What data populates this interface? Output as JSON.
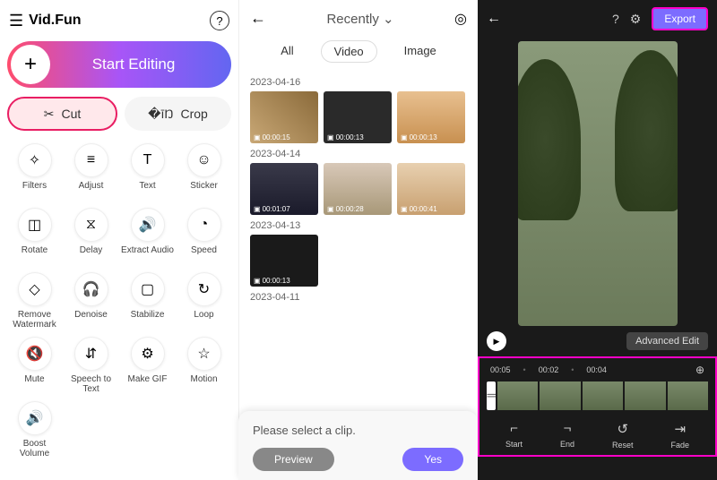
{
  "p1": {
    "logo": "Vid.Fun",
    "start": "Start Editing",
    "cut": "Cut",
    "crop": "Crop",
    "tools": [
      {
        "label": "Filters",
        "icon": "✧"
      },
      {
        "label": "Adjust",
        "icon": "≡"
      },
      {
        "label": "Text",
        "icon": "T"
      },
      {
        "label": "Sticker",
        "icon": "☺"
      },
      {
        "label": "Rotate",
        "icon": "◫"
      },
      {
        "label": "Delay",
        "icon": "⧖"
      },
      {
        "label": "Extract Audio",
        "icon": "🔊"
      },
      {
        "label": "Speed",
        "icon": "◔"
      },
      {
        "label": "Remove Watermark",
        "icon": "◇"
      },
      {
        "label": "Denoise",
        "icon": "🎧"
      },
      {
        "label": "Stabilize",
        "icon": "▢"
      },
      {
        "label": "Loop",
        "icon": "↻"
      },
      {
        "label": "Mute",
        "icon": "🔇"
      },
      {
        "label": "Speech to Text",
        "icon": "⇵"
      },
      {
        "label": "Make GIF",
        "icon": "⚙"
      },
      {
        "label": "Motion",
        "icon": "☆"
      },
      {
        "label": "Boost Volume",
        "icon": "🔊"
      }
    ]
  },
  "p2": {
    "recent": "Recently",
    "tabs": {
      "all": "All",
      "video": "Video",
      "image": "Image"
    },
    "groups": [
      {
        "date": "2023-04-16",
        "items": [
          "00:00:15",
          "00:00:13",
          "00:00:13"
        ]
      },
      {
        "date": "2023-04-14",
        "items": [
          "00:01:07",
          "00:00:28",
          "00:00:41"
        ]
      },
      {
        "date": "2023-04-13",
        "items": [
          "00:00:13"
        ]
      },
      {
        "date": "2023-04-11",
        "items": []
      }
    ],
    "dialog": {
      "msg": "Please select a clip.",
      "preview": "Preview",
      "yes": "Yes"
    }
  },
  "p3": {
    "export": "Export",
    "advanced": "Advanced Edit",
    "times": [
      "00:05",
      "00:02",
      "00:04"
    ],
    "actions": [
      {
        "label": "Start",
        "icon": "⌐"
      },
      {
        "label": "End",
        "icon": "¬"
      },
      {
        "label": "Reset",
        "icon": "↺"
      },
      {
        "label": "Fade",
        "icon": "⇥"
      }
    ]
  }
}
